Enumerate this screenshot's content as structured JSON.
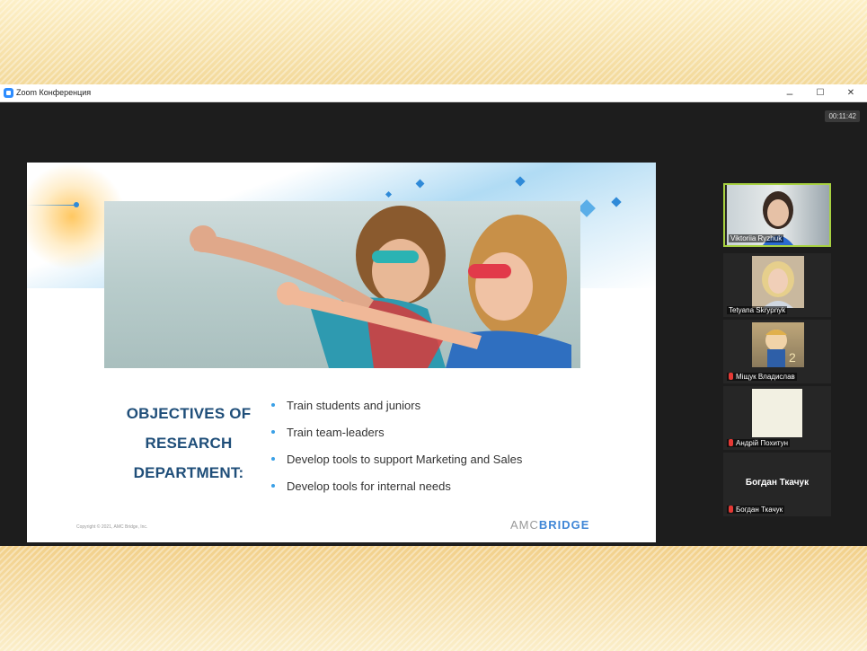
{
  "window": {
    "title": "Zoom Конференция",
    "minimize": "–",
    "maximize": "☐",
    "close": "✕",
    "timer": "00:11:42"
  },
  "slide": {
    "title_line1": "OBJECTIVES OF",
    "title_line2": "RESEARCH",
    "title_line3": "DEPARTMENT:",
    "bullets": [
      "Train students and juniors",
      "Train team-leaders",
      "Develop tools to support Marketing and Sales",
      "Develop tools for internal needs"
    ],
    "copyright": "Copyright © 2021, AMC Bridge, Inc.",
    "logo_amc": "AMC",
    "logo_bridge": "BRIDGE"
  },
  "participants": [
    {
      "name": "Viktoriia Ryzhuk",
      "muted": false,
      "active": true
    },
    {
      "name": "Tetyana Skrypnyk",
      "muted": false,
      "active": false
    },
    {
      "name": "Міщук Владислав",
      "muted": true,
      "active": false
    },
    {
      "name": "Андрій Похитун",
      "muted": true,
      "active": false
    },
    {
      "name": "Богдан Ткачук",
      "muted": true,
      "active": false,
      "display_name": "Богдан Ткачук"
    }
  ],
  "colors": {
    "accent_blue": "#2f8ad8",
    "title_navy": "#1f4e79",
    "active_speaker": "#a7d141",
    "muted_red": "#e53935"
  }
}
